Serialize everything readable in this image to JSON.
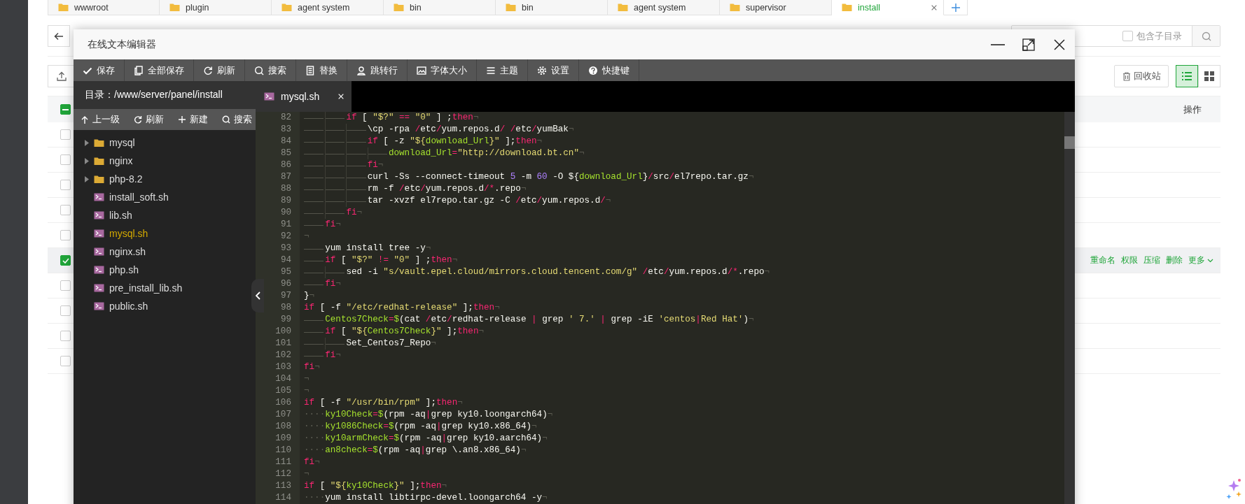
{
  "page_tabs": [
    {
      "label": "wwwroot",
      "selected": false
    },
    {
      "label": "plugin",
      "selected": false
    },
    {
      "label": "agent system",
      "selected": false
    },
    {
      "label": "bin",
      "selected": false
    },
    {
      "label": "bin",
      "selected": false
    },
    {
      "label": "agent system",
      "selected": false
    },
    {
      "label": "supervisor",
      "selected": false
    },
    {
      "label": "install",
      "selected": true
    }
  ],
  "search": {
    "include_subdirs": {
      "label": "包含子目录",
      "checked": false
    }
  },
  "recycle_button": "回收站",
  "view_modes": [
    {
      "selected": true
    },
    {
      "selected": false
    }
  ],
  "table": {
    "header_checkbox": {
      "indeterminate": true
    },
    "action_column": "操作",
    "rows": [
      {
        "checked": false
      },
      {
        "checked": false
      },
      {
        "checked": false
      },
      {
        "checked": false
      },
      {
        "checked": false
      },
      {
        "checked": true,
        "actions": [
          "重命名",
          "权限",
          "压缩",
          "删除",
          "更多"
        ]
      },
      {
        "checked": false
      },
      {
        "checked": false
      },
      {
        "checked": false
      },
      {
        "checked": false
      }
    ]
  },
  "editor": {
    "title": "在线文本编辑器",
    "toolbar": [
      "保存",
      "全部保存",
      "刷新",
      "搜索",
      "替换",
      "跳转行",
      "字体大小",
      "主题",
      "设置",
      "快捷键"
    ],
    "sidebar": {
      "path": "目录：/www/server/panel/install",
      "tools": [
        "上一级",
        "刷新",
        "新建",
        "搜索"
      ],
      "tree": [
        {
          "name": "mysql",
          "kind": "folder",
          "expanded": false,
          "selected": false
        },
        {
          "name": "nginx",
          "kind": "folder",
          "expanded": false,
          "selected": false
        },
        {
          "name": "php-8.2",
          "kind": "folder",
          "expanded": false,
          "selected": false
        },
        {
          "name": "install_soft.sh",
          "kind": "file",
          "selected": false
        },
        {
          "name": "lib.sh",
          "kind": "file",
          "selected": false
        },
        {
          "name": "mysql.sh",
          "kind": "file",
          "selected": true
        },
        {
          "name": "nginx.sh",
          "kind": "file",
          "selected": false
        },
        {
          "name": "php.sh",
          "kind": "file",
          "selected": false
        },
        {
          "name": "pre_install_lib.sh",
          "kind": "file",
          "selected": false
        },
        {
          "name": "public.sh",
          "kind": "file",
          "selected": false
        }
      ]
    },
    "tabs": [
      {
        "label": "mysql.sh",
        "selected": true
      }
    ],
    "lines": [
      {
        "number": "82",
        "end": "¬",
        "segments": [
          {
            "kind": "tab"
          },
          {
            "kind": "tab"
          },
          {
            "kind": "keyword",
            "text": "if"
          },
          {
            "kind": "plain",
            "text": " [ "
          },
          {
            "kind": "string",
            "text": "\"$?\""
          },
          {
            "kind": "operator",
            "text": " == "
          },
          {
            "kind": "string",
            "text": "\"0\""
          },
          {
            "kind": "plain",
            "text": " ] ;"
          },
          {
            "kind": "keyword",
            "text": "then"
          }
        ]
      },
      {
        "number": "83",
        "end": "¬",
        "segments": [
          {
            "kind": "tab"
          },
          {
            "kind": "tab"
          },
          {
            "kind": "tab"
          },
          {
            "kind": "plain",
            "text": "\\cp -rpa "
          },
          {
            "kind": "operator",
            "text": "/"
          },
          {
            "kind": "plain",
            "text": "etc"
          },
          {
            "kind": "operator",
            "text": "/"
          },
          {
            "kind": "plain",
            "text": "yum.repos.d"
          },
          {
            "kind": "operator",
            "text": "/ /"
          },
          {
            "kind": "plain",
            "text": "etc"
          },
          {
            "kind": "operator",
            "text": "/"
          },
          {
            "kind": "plain",
            "text": "yumBak"
          }
        ]
      },
      {
        "number": "84",
        "end": "¬",
        "segments": [
          {
            "kind": "tab"
          },
          {
            "kind": "tab"
          },
          {
            "kind": "tab"
          },
          {
            "kind": "keyword",
            "text": "if"
          },
          {
            "kind": "plain",
            "text": " [ -z "
          },
          {
            "kind": "string",
            "text": "\"${"
          },
          {
            "kind": "variable",
            "text": "download_Url"
          },
          {
            "kind": "string",
            "text": "}\""
          },
          {
            "kind": "plain",
            "text": " ];"
          },
          {
            "kind": "keyword",
            "text": "then"
          }
        ]
      },
      {
        "number": "85",
        "end": "¬",
        "segments": [
          {
            "kind": "tab"
          },
          {
            "kind": "tab"
          },
          {
            "kind": "tab"
          },
          {
            "kind": "tab"
          },
          {
            "kind": "variable",
            "text": "download_Url"
          },
          {
            "kind": "operator",
            "text": "="
          },
          {
            "kind": "string",
            "text": "\"http://download.bt.cn\""
          }
        ]
      },
      {
        "number": "86",
        "end": "¬",
        "segments": [
          {
            "kind": "tab"
          },
          {
            "kind": "tab"
          },
          {
            "kind": "tab"
          },
          {
            "kind": "keyword",
            "text": "fi"
          }
        ]
      },
      {
        "number": "87",
        "end": "¬",
        "segments": [
          {
            "kind": "tab"
          },
          {
            "kind": "tab"
          },
          {
            "kind": "tab"
          },
          {
            "kind": "plain",
            "text": "curl -Ss --connect-timeout "
          },
          {
            "kind": "number",
            "text": "5"
          },
          {
            "kind": "plain",
            "text": " -m "
          },
          {
            "kind": "number",
            "text": "60"
          },
          {
            "kind": "plain",
            "text": " -O ${"
          },
          {
            "kind": "variable",
            "text": "download_Url"
          },
          {
            "kind": "plain",
            "text": "}"
          },
          {
            "kind": "operator",
            "text": "/"
          },
          {
            "kind": "plain",
            "text": "src"
          },
          {
            "kind": "operator",
            "text": "/"
          },
          {
            "kind": "plain",
            "text": "el7repo.tar.gz"
          }
        ]
      },
      {
        "number": "88",
        "end": "¬",
        "segments": [
          {
            "kind": "tab"
          },
          {
            "kind": "tab"
          },
          {
            "kind": "tab"
          },
          {
            "kind": "plain",
            "text": "rm -f "
          },
          {
            "kind": "operator",
            "text": "/"
          },
          {
            "kind": "plain",
            "text": "etc"
          },
          {
            "kind": "operator",
            "text": "/"
          },
          {
            "kind": "plain",
            "text": "yum.repos.d"
          },
          {
            "kind": "operator",
            "text": "/*"
          },
          {
            "kind": "plain",
            "text": ".repo"
          }
        ]
      },
      {
        "number": "89",
        "end": "¬",
        "segments": [
          {
            "kind": "tab"
          },
          {
            "kind": "tab"
          },
          {
            "kind": "tab"
          },
          {
            "kind": "plain",
            "text": "tar -xvzf el7repo.tar.gz -C "
          },
          {
            "kind": "operator",
            "text": "/"
          },
          {
            "kind": "plain",
            "text": "etc"
          },
          {
            "kind": "operator",
            "text": "/"
          },
          {
            "kind": "plain",
            "text": "yum.repos.d"
          },
          {
            "kind": "operator",
            "text": "/"
          }
        ]
      },
      {
        "number": "90",
        "end": "¬",
        "segments": [
          {
            "kind": "tab"
          },
          {
            "kind": "tab"
          },
          {
            "kind": "keyword",
            "text": "fi"
          }
        ]
      },
      {
        "number": "91",
        "end": "¬",
        "segments": [
          {
            "kind": "tab"
          },
          {
            "kind": "keyword",
            "text": "fi"
          }
        ]
      },
      {
        "number": "92",
        "end": "¬"
      },
      {
        "number": "93",
        "end": "¬",
        "segments": [
          {
            "kind": "tab"
          },
          {
            "kind": "plain",
            "text": "yum install tree -y"
          }
        ]
      },
      {
        "number": "94",
        "end": "¬",
        "segments": [
          {
            "kind": "tab"
          },
          {
            "kind": "keyword",
            "text": "if"
          },
          {
            "kind": "plain",
            "text": " [ "
          },
          {
            "kind": "string",
            "text": "\"$?\""
          },
          {
            "kind": "operator",
            "text": " != "
          },
          {
            "kind": "string",
            "text": "\"0\""
          },
          {
            "kind": "plain",
            "text": " ] ;"
          },
          {
            "kind": "keyword",
            "text": "then"
          }
        ]
      },
      {
        "number": "95",
        "end": "¬",
        "segments": [
          {
            "kind": "tab"
          },
          {
            "kind": "tab"
          },
          {
            "kind": "plain",
            "text": "sed -i "
          },
          {
            "kind": "string",
            "text": "\"s/vault.epel.cloud/mirrors.cloud.tencent.com/g\""
          },
          {
            "kind": "operator",
            "text": " /"
          },
          {
            "kind": "plain",
            "text": "etc"
          },
          {
            "kind": "operator",
            "text": "/"
          },
          {
            "kind": "plain",
            "text": "yum.repos.d"
          },
          {
            "kind": "operator",
            "text": "/*"
          },
          {
            "kind": "plain",
            "text": ".repo"
          }
        ]
      },
      {
        "number": "96",
        "end": "¬",
        "segments": [
          {
            "kind": "tab"
          },
          {
            "kind": "keyword",
            "text": "fi"
          }
        ]
      },
      {
        "number": "97",
        "end": "¬",
        "segments": [
          {
            "kind": "plain",
            "text": "}"
          }
        ]
      },
      {
        "number": "98",
        "end": "¬",
        "segments": [
          {
            "kind": "keyword",
            "text": "if"
          },
          {
            "kind": "plain",
            "text": " [ -f "
          },
          {
            "kind": "string",
            "text": "\"/etc/redhat-release\""
          },
          {
            "kind": "plain",
            "text": " ];"
          },
          {
            "kind": "keyword",
            "text": "then"
          }
        ]
      },
      {
        "number": "99",
        "end": "¬",
        "segments": [
          {
            "kind": "tab"
          },
          {
            "kind": "variable",
            "text": "Centos7Check"
          },
          {
            "kind": "operator",
            "text": "="
          },
          {
            "kind": "variable",
            "text": "$"
          },
          {
            "kind": "plain",
            "text": "(cat "
          },
          {
            "kind": "operator",
            "text": "/"
          },
          {
            "kind": "plain",
            "text": "etc"
          },
          {
            "kind": "operator",
            "text": "/"
          },
          {
            "kind": "plain",
            "text": "redhat-release "
          },
          {
            "kind": "operator",
            "text": "|"
          },
          {
            "kind": "plain",
            "text": " grep "
          },
          {
            "kind": "string",
            "text": "' 7.'"
          },
          {
            "kind": "operator",
            "text": " |"
          },
          {
            "kind": "plain",
            "text": " grep -iE "
          },
          {
            "kind": "string",
            "text": "'centos"
          },
          {
            "kind": "operator",
            "text": "|"
          },
          {
            "kind": "string",
            "text": "Red Hat'"
          },
          {
            "kind": "plain",
            "text": ")"
          }
        ]
      },
      {
        "number": "100",
        "end": "¬",
        "segments": [
          {
            "kind": "tab"
          },
          {
            "kind": "keyword",
            "text": "if"
          },
          {
            "kind": "plain",
            "text": " [ "
          },
          {
            "kind": "string",
            "text": "\"${"
          },
          {
            "kind": "variable",
            "text": "Centos7Check"
          },
          {
            "kind": "string",
            "text": "}\""
          },
          {
            "kind": "plain",
            "text": " ];"
          },
          {
            "kind": "keyword",
            "text": "then"
          }
        ]
      },
      {
        "number": "101",
        "end": "¬",
        "segments": [
          {
            "kind": "tab"
          },
          {
            "kind": "tab"
          },
          {
            "kind": "plain",
            "text": "Set_Centos7_Repo"
          }
        ]
      },
      {
        "number": "102",
        "end": "¬",
        "segments": [
          {
            "kind": "tab"
          },
          {
            "kind": "keyword",
            "text": "fi"
          }
        ]
      },
      {
        "number": "103",
        "end": "¬",
        "segments": [
          {
            "kind": "keyword",
            "text": "fi"
          }
        ]
      },
      {
        "number": "104",
        "end": "¬"
      },
      {
        "number": "105",
        "end": "¬"
      },
      {
        "number": "106",
        "end": "¬",
        "segments": [
          {
            "kind": "keyword",
            "text": "if"
          },
          {
            "kind": "plain",
            "text": " [ -f "
          },
          {
            "kind": "string",
            "text": "\"/usr/bin/rpm\""
          },
          {
            "kind": "plain",
            "text": " ];"
          },
          {
            "kind": "keyword",
            "text": "then"
          }
        ]
      },
      {
        "number": "107",
        "end": "¬",
        "segments": [
          {
            "kind": "spaces",
            "text": "····"
          },
          {
            "kind": "variable",
            "text": "ky10Check"
          },
          {
            "kind": "operator",
            "text": "="
          },
          {
            "kind": "variable",
            "text": "$"
          },
          {
            "kind": "plain",
            "text": "(rpm -aq"
          },
          {
            "kind": "operator",
            "text": "|"
          },
          {
            "kind": "plain",
            "text": "grep ky10.loongarch64)"
          }
        ]
      },
      {
        "number": "108",
        "end": "¬",
        "segments": [
          {
            "kind": "spaces",
            "text": "····"
          },
          {
            "kind": "variable",
            "text": "ky1086Check"
          },
          {
            "kind": "operator",
            "text": "="
          },
          {
            "kind": "variable",
            "text": "$"
          },
          {
            "kind": "plain",
            "text": "(rpm -aq"
          },
          {
            "kind": "operator",
            "text": "|"
          },
          {
            "kind": "plain",
            "text": "grep ky10.x86_64)"
          }
        ]
      },
      {
        "number": "109",
        "end": "¬",
        "segments": [
          {
            "kind": "spaces",
            "text": "····"
          },
          {
            "kind": "variable",
            "text": "ky10armCheck"
          },
          {
            "kind": "operator",
            "text": "="
          },
          {
            "kind": "variable",
            "text": "$"
          },
          {
            "kind": "plain",
            "text": "(rpm -aq"
          },
          {
            "kind": "operator",
            "text": "|"
          },
          {
            "kind": "plain",
            "text": "grep ky10.aarch64)"
          }
        ]
      },
      {
        "number": "110",
        "end": "¬",
        "segments": [
          {
            "kind": "spaces",
            "text": "····"
          },
          {
            "kind": "variable",
            "text": "an8check"
          },
          {
            "kind": "operator",
            "text": "="
          },
          {
            "kind": "variable",
            "text": "$"
          },
          {
            "kind": "plain",
            "text": "(rpm -aq"
          },
          {
            "kind": "operator",
            "text": "|"
          },
          {
            "kind": "plain",
            "text": "grep \\.an8.x86_64)"
          }
        ]
      },
      {
        "number": "111",
        "end": "¬",
        "segments": [
          {
            "kind": "keyword",
            "text": "fi"
          }
        ]
      },
      {
        "number": "112",
        "end": "¬"
      },
      {
        "number": "113",
        "end": "¬",
        "segments": [
          {
            "kind": "keyword",
            "text": "if"
          },
          {
            "kind": "plain",
            "text": " [ "
          },
          {
            "kind": "string",
            "text": "\"${"
          },
          {
            "kind": "variable",
            "text": "ky10Check"
          },
          {
            "kind": "string",
            "text": "}\""
          },
          {
            "kind": "plain",
            "text": " ];"
          },
          {
            "kind": "keyword",
            "text": "then"
          }
        ]
      },
      {
        "number": "114",
        "end": "¬",
        "segments": [
          {
            "kind": "spaces",
            "text": "····"
          },
          {
            "kind": "plain",
            "text": "yum install libtirpc-devel.loongarch64 -y"
          }
        ]
      }
    ]
  }
}
